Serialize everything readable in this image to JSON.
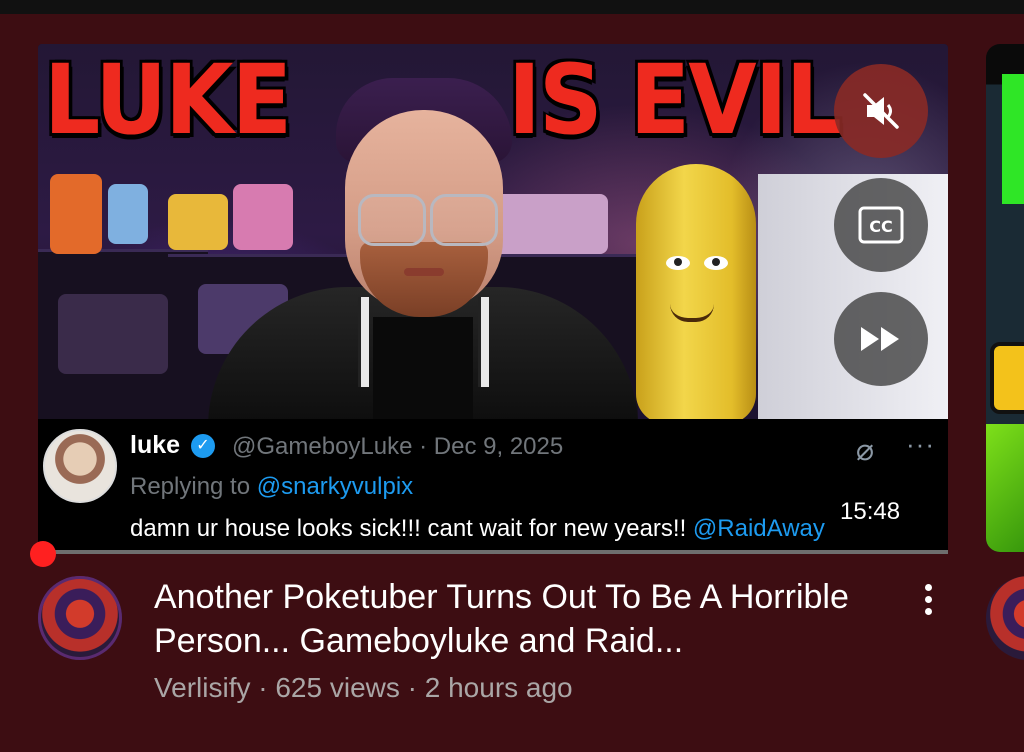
{
  "thumbnail": {
    "headline_left": "LUKE",
    "headline_right": "IS EVIL",
    "duration": "15:48",
    "tweet": {
      "display_name": "luke",
      "verified_icon": "verified-check-icon",
      "handle_date": "@GameboyLuke · Dec 9, 2025",
      "replying_prefix": "Replying to ",
      "replying_to": "@snarkyvulpix",
      "body": "damn ur house looks sick!!! cant wait for new years!! ",
      "body_mention": "@RaidAway",
      "more": "···"
    }
  },
  "overlay_controls": {
    "mute_icon": "muted-speaker-icon",
    "captions_icon": "closed-captions-icon",
    "captions_label": "CC",
    "fastforward_icon": "fast-forward-icon",
    "mute_bg": "#8a2a26"
  },
  "progress": {
    "fraction": 0.0
  },
  "video": {
    "title": "Another Poketuber Turns Out To Be A Horrible Person... Gameboyluke and Raid...",
    "channel": "Verlisify",
    "views": "625 views",
    "age": "2 hours ago",
    "subtitle": "Verlisify · 625 views · 2 hours ago"
  },
  "colors": {
    "background": "#3d0d12",
    "accent": "#ff0000",
    "link": "#1d9bf0"
  }
}
